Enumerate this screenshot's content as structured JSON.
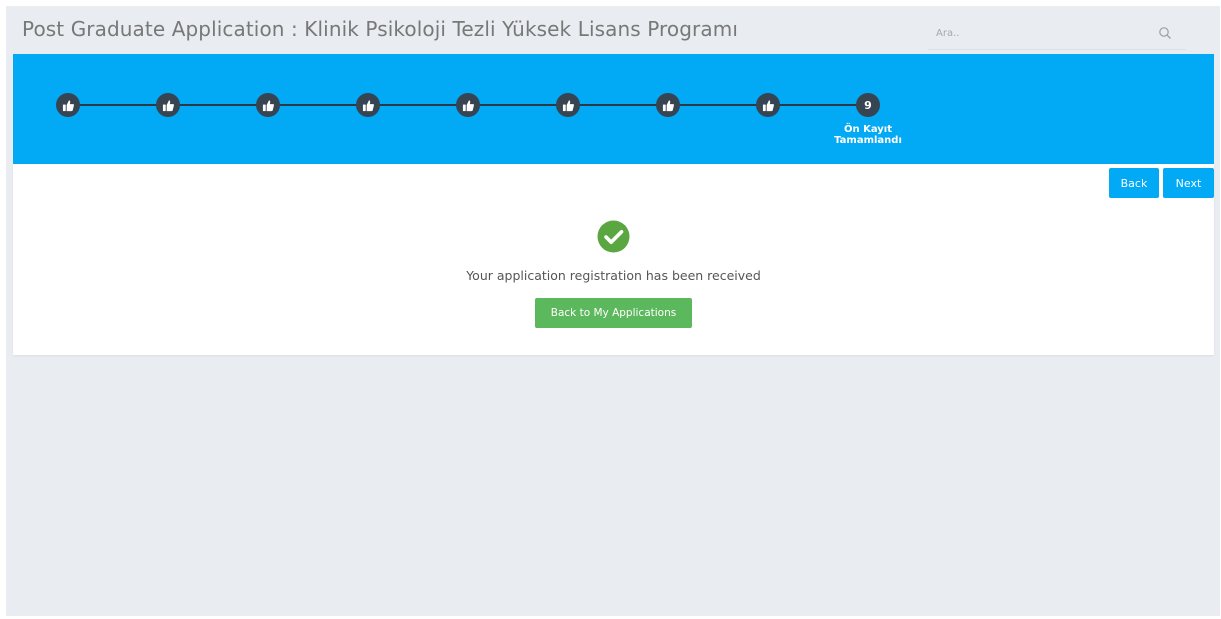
{
  "header": {
    "title": "Post Graduate Application : Klinik Psikoloji Tezli Yüksek Lisans Programı",
    "search_placeholder": "Ara.."
  },
  "stepper": {
    "completed_icon": "thumbs-up-icon",
    "completed_steps": 8,
    "current_step": {
      "number": "9",
      "label": "Ön Kayıt Tamamlandı"
    }
  },
  "toolbar": {
    "back_label": "Back",
    "next_label": "Next"
  },
  "result": {
    "icon": "check-circle-icon",
    "message": "Your application registration has been received",
    "button_label": "Back to My Applications"
  },
  "colors": {
    "accent_blue": "#02a9f4",
    "step_dark": "#374452",
    "success_green": "#5cb85c",
    "check_green": "#5aa641"
  }
}
